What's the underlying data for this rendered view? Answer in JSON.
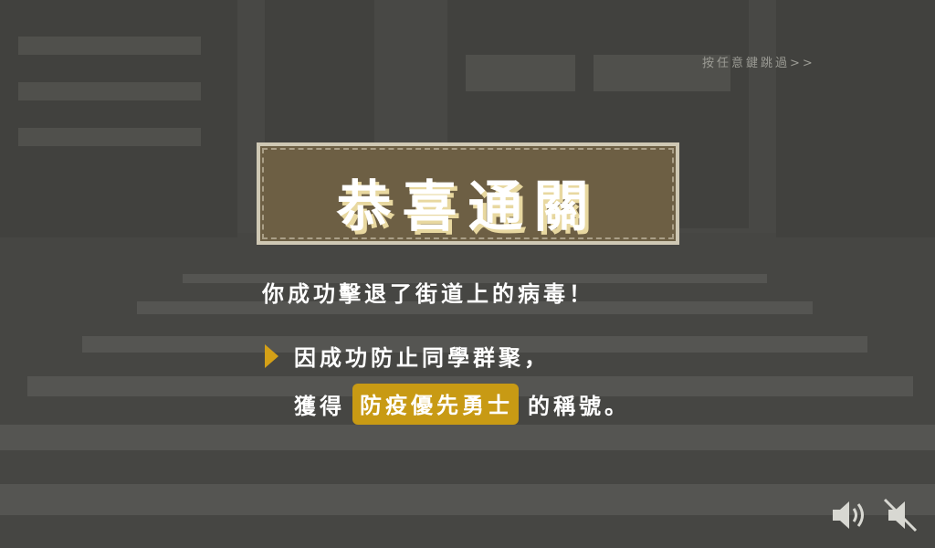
{
  "skip_hint": "按任意鍵跳過>>",
  "title": "恭喜通關",
  "message_line1": "你成功擊退了街道上的病毒！",
  "message_line2": "因成功防止同學群聚，",
  "message_line3_prefix": "獲得",
  "message_line3_highlight": "防疫優先勇士",
  "message_line3_suffix": "的稱號。",
  "icons": {
    "sound_on": "speaker-on-icon",
    "sound_off": "speaker-muted-icon"
  },
  "colors": {
    "accent": "#c89a14",
    "title_box": "#6d5f44",
    "background": "#4a4a47"
  }
}
